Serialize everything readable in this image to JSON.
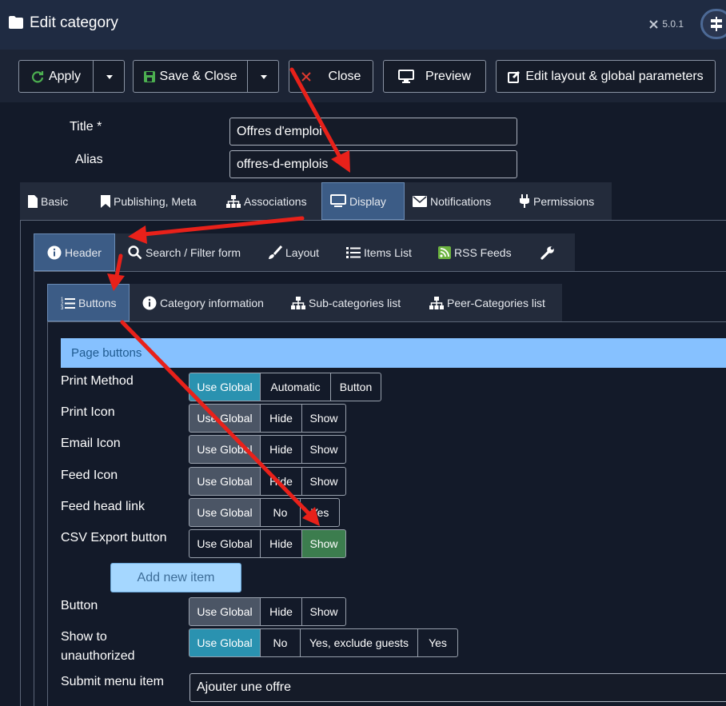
{
  "header": {
    "title": "Edit category",
    "version": "5.0.1"
  },
  "toolbar": {
    "apply": "Apply",
    "save_close": "Save & Close",
    "close": "Close",
    "preview": "Preview",
    "edit_layout": "Edit layout & global parameters"
  },
  "form": {
    "title_label": "Title *",
    "title_value": "Offres d'emploi",
    "alias_label": "Alias",
    "alias_value": "offres-d-emplois"
  },
  "main_tabs": [
    "Basic",
    "Publishing, Meta",
    "Associations",
    "Display",
    "Notifications",
    "Permissions"
  ],
  "display_tabs": [
    "Header",
    "Search / Filter form",
    "Layout",
    "Items List",
    "RSS Feeds"
  ],
  "header_tabs": [
    "Buttons",
    "Category information",
    "Sub-categories list",
    "Peer-Categories list"
  ],
  "section": {
    "title": "Page buttons"
  },
  "rows": [
    {
      "label": "Print Method",
      "options": [
        "Use Global",
        "Automatic",
        "Button"
      ],
      "selected": "Use Global"
    },
    {
      "label": "Print Icon",
      "options": [
        "Use Global",
        "Hide",
        "Show"
      ],
      "selected": "Use Global"
    },
    {
      "label": "Email Icon",
      "options": [
        "Use Global",
        "Hide",
        "Show"
      ],
      "selected": "Use Global"
    },
    {
      "label": "Feed Icon",
      "options": [
        "Use Global",
        "Hide",
        "Show"
      ],
      "selected": "Use Global"
    },
    {
      "label": "Feed head link",
      "options": [
        "Use Global",
        "No",
        "Yes"
      ],
      "selected": "Use Global"
    },
    {
      "label": "CSV Export button",
      "options": [
        "Use Global",
        "Hide",
        "Show"
      ],
      "selected": "Show"
    }
  ],
  "add_button": "Add new item",
  "rows2": [
    {
      "label": "Button",
      "options": [
        "Use Global",
        "Hide",
        "Show"
      ],
      "selected": "Use Global"
    },
    {
      "label_line1": "Show to",
      "label_line2": "unauthorized",
      "options": [
        "Use Global",
        "No",
        "Yes, exclude guests",
        "Yes"
      ],
      "selected": "Use Global"
    }
  ],
  "submit_menu": {
    "label": "Submit menu item",
    "value": "Ajouter une offre"
  },
  "colors": {
    "accent_teal": "#2a92b0",
    "selected_green": "#3c7d4e",
    "active_tab": "#3c5c86",
    "annotation_arrow": "#e8211a"
  }
}
